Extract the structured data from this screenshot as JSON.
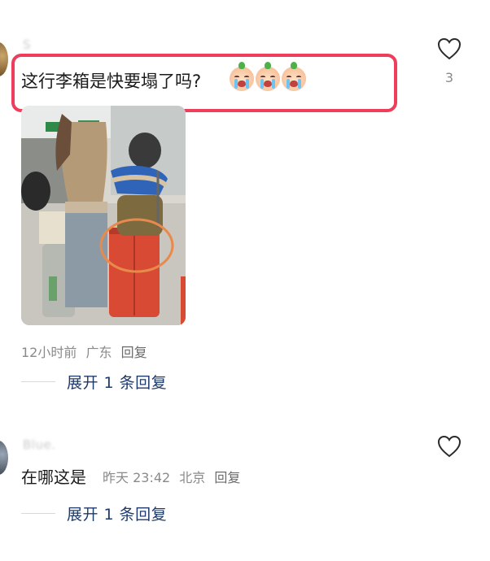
{
  "comments": [
    {
      "username": "S",
      "text": "这行李箱是快要塌了吗?",
      "emojis": [
        "crying-face-emoji",
        "crying-face-emoji",
        "crying-face-emoji"
      ],
      "likes": "3",
      "time": "12小时前",
      "location": "广东",
      "reply": "回复",
      "expand": "展开 1 条回复"
    },
    {
      "username": "Blue.",
      "text": "在哪这是",
      "time": "昨天 23:42",
      "location": "北京",
      "reply": "回复",
      "expand": "展开 1 条回复"
    }
  ],
  "colors": {
    "highlight_border": "#ef3e5b",
    "expand_text": "#1e3a6b",
    "meta_text": "#8a8a8a"
  },
  "icons": [
    "heart-outline-icon",
    "heart-outline-icon"
  ]
}
